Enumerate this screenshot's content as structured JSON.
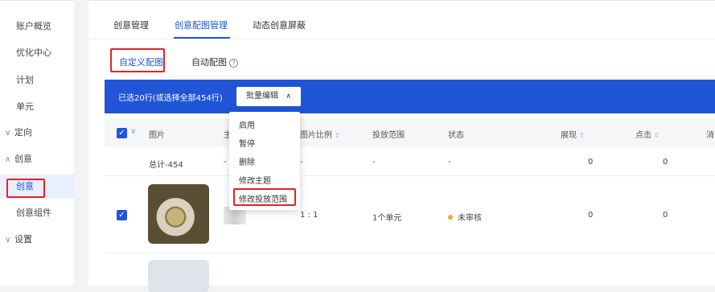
{
  "sidebar": {
    "items": [
      {
        "label": "账户概览"
      },
      {
        "label": "优化中心"
      },
      {
        "label": "计划"
      },
      {
        "label": "单元"
      },
      {
        "label": "定向",
        "chevron": "∨"
      },
      {
        "label": "创意",
        "chevron": "∧"
      },
      {
        "label": "创意"
      },
      {
        "label": "创意组件"
      },
      {
        "label": "设置",
        "chevron": "∨"
      }
    ]
  },
  "tabs": [
    {
      "label": "创意管理"
    },
    {
      "label": "创意配图管理"
    },
    {
      "label": "动态创意屏蔽"
    }
  ],
  "subtabs": [
    {
      "label": "自定义配图"
    },
    {
      "label": "自动配图"
    }
  ],
  "help_icon": "?",
  "bulk_bar": {
    "selection_text": "已选20行(或选择全部454行)",
    "batch_button": "批量编辑",
    "caret": "∧"
  },
  "dropdown": {
    "items": [
      "启用",
      "暂停",
      "删除",
      "修改主题",
      "修改投放范围"
    ]
  },
  "table": {
    "headers": {
      "image": "图片",
      "theme": "主",
      "ratio": "图片比例",
      "scope": "投放范围",
      "status": "状态",
      "impressions": "展现",
      "clicks": "点击",
      "cut": "消"
    },
    "sort_icon": "⇕",
    "check_mark": "✓",
    "select_caret": "∨",
    "total_row": {
      "label": "总计-454",
      "theme": "-",
      "ratio": "-",
      "scope": "-",
      "status": "-",
      "impressions": "0",
      "clicks": "0"
    },
    "rows": [
      {
        "ratio": "1 : 1",
        "scope": "1个单元",
        "status": "未审核",
        "status_color": "#f5a623",
        "impressions": "0",
        "clicks": "0"
      }
    ]
  },
  "colors": {
    "accent": "#1f55d6",
    "highlight_box": "#e02424",
    "status_pending": "#f5a623"
  }
}
